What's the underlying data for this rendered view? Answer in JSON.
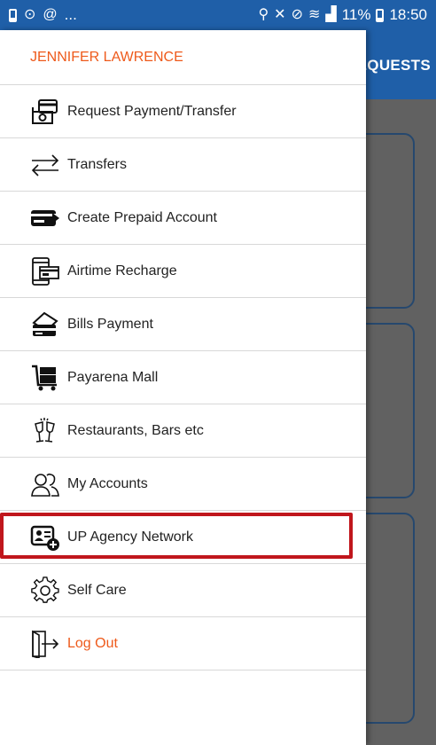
{
  "status_bar": {
    "left_indicator": "...",
    "battery_percent": "11%",
    "time": "18:50"
  },
  "app": {
    "tab_label": "EQUESTS"
  },
  "drawer": {
    "user_name": "JENNIFER LAWRENCE",
    "items": [
      {
        "label": "Request Payment/Transfer",
        "icon": "payment-request-icon"
      },
      {
        "label": "Transfers",
        "icon": "transfer-arrows-icon"
      },
      {
        "label": "Create Prepaid Account",
        "icon": "prepaid-card-icon"
      },
      {
        "label": "Airtime Recharge",
        "icon": "phone-card-icon"
      },
      {
        "label": "Bills Payment",
        "icon": "bill-card-icon"
      },
      {
        "label": "Payarena Mall",
        "icon": "shopping-cart-icon"
      },
      {
        "label": "Restaurants, Bars etc",
        "icon": "cheers-glasses-icon"
      },
      {
        "label": "My Accounts",
        "icon": "users-icon"
      },
      {
        "label": "UP Agency Network",
        "icon": "agency-id-icon"
      },
      {
        "label": "Self Care",
        "icon": "gear-icon"
      },
      {
        "label": "Log Out",
        "icon": "logout-door-icon"
      }
    ]
  },
  "colors": {
    "brand_blue": "#1f5fa8",
    "accent_orange": "#ee5a1b",
    "highlight_red": "#c0161c"
  }
}
